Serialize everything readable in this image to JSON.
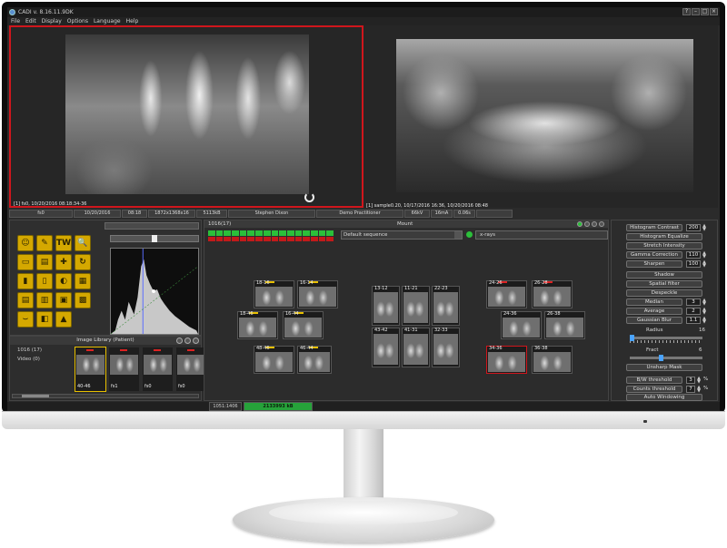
{
  "window": {
    "title": "CADI v. 8.16.11.9DK",
    "controls": [
      "?",
      "–",
      "□",
      "×"
    ]
  },
  "menu": [
    "File",
    "Edit",
    "Display",
    "Options",
    "Language",
    "Help"
  ],
  "viewers": {
    "left_caption": "[1] fs0, 10/20/2016 08:18:34-36",
    "right_caption": "[1] sample0.20, 10/17/2016 16:36, 10/20/2016 08:48"
  },
  "info_bar": [
    "fs0",
    "10/20/2016",
    "08:18",
    "1872x1368x16",
    "5113kB",
    "Stephen Dixon",
    "Demo Practitioner",
    "66kV",
    "16mA",
    "0.06s"
  ],
  "tools": [
    "☺",
    "✎",
    "TW",
    "🔍",
    "▭",
    "▤",
    "✚",
    "↻",
    "▮",
    "▯",
    "◐",
    "▦",
    "▤",
    "▥",
    "▣",
    "▩",
    "⌣",
    "◧",
    "▲",
    ""
  ],
  "library": {
    "title": "Image Library (Patient)",
    "rows": [
      "1016 (17)",
      "Video (0)"
    ],
    "thumbs": [
      "40-46",
      "fs1",
      "fs0",
      "fs0"
    ]
  },
  "mount": {
    "id": "1016(17)",
    "title": "Mount",
    "sequence": "Default sequence",
    "type": "x-rays",
    "upper_left": [
      "18-16",
      "16-14"
    ],
    "mid_left": [
      "18-46",
      "16-44"
    ],
    "lower_left": [
      "48-46",
      "46-44"
    ],
    "anterior_upper": [
      "13-12",
      "11-21",
      "22-23"
    ],
    "anterior_lower": [
      "43-42",
      "41-31",
      "32-33"
    ],
    "upper_right": [
      "24-26",
      "26-28"
    ],
    "mid_right": [
      "24-36",
      "26-38"
    ],
    "lower_right": [
      "34-36",
      "36-38"
    ]
  },
  "controls": {
    "histogram_contrast": {
      "label": "Histogram Contrast",
      "value": "200"
    },
    "histogram_equalize": "Histogram Equalize",
    "stretch_intensity": "Stretch Intensity",
    "gamma_correction": {
      "label": "Gamma Correction",
      "value": "110"
    },
    "sharpen": {
      "label": "Sharpen",
      "value": "100"
    },
    "shadow": "Shadow",
    "spatial_filter": "Spatial filter",
    "despeckle": "Despeckle",
    "median": {
      "label": "Median",
      "value": "3"
    },
    "average": {
      "label": "Average",
      "value": "2"
    },
    "gaussian_blur": {
      "label": "Gaussian Blur",
      "value": "1.1"
    },
    "radius": {
      "label": "Radius",
      "value": "16"
    },
    "fract": {
      "label": "Fract",
      "value": "6"
    },
    "unsharp_mask": "Unsharp Mask",
    "bw_threshold": {
      "label": "B/W threshold",
      "value": "3",
      "unit": "%"
    },
    "counts_threshold": {
      "label": "Counts threshold",
      "value": "7",
      "unit": "%"
    },
    "auto_windowing": "Auto Windowing"
  },
  "status": {
    "coords": "1051:1406",
    "progress": "2133993 kB"
  }
}
